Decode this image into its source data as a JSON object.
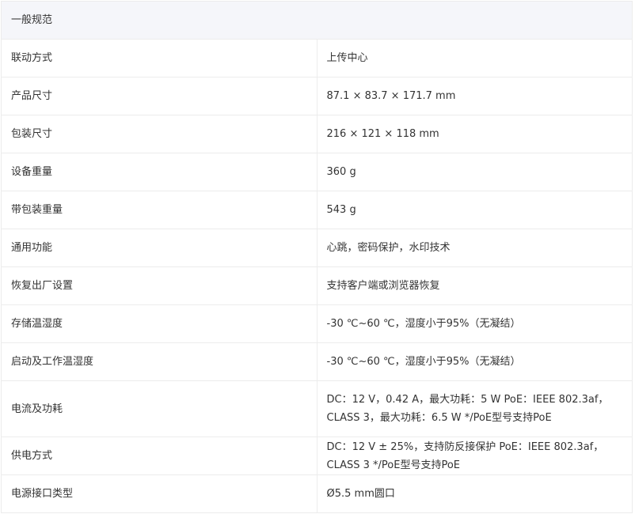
{
  "section_title": "一般规范",
  "rows": [
    {
      "label": "联动方式",
      "value": "上传中心"
    },
    {
      "label": "产品尺寸",
      "value": "87.1 × 83.7 × 171.7 mm"
    },
    {
      "label": "包装尺寸",
      "value": "216 × 121 × 118 mm"
    },
    {
      "label": "设备重量",
      "value": "360 g"
    },
    {
      "label": "带包装重量",
      "value": "543 g"
    },
    {
      "label": "通用功能",
      "value": "心跳，密码保护，水印技术"
    },
    {
      "label": "恢复出厂设置",
      "value": "支持客户端或浏览器恢复"
    },
    {
      "label": "存储温湿度",
      "value": "-30 ℃~60 ℃，湿度小于95%（无凝结）"
    },
    {
      "label": "启动及工作温湿度",
      "value": "-30 ℃~60 ℃，湿度小于95%（无凝结）"
    },
    {
      "label": "电流及功耗",
      "value": "DC：12 V，0.42 A，最大功耗：5 W PoE：IEEE 802.3af，CLASS 3，最大功耗：6.5 W */PoE型号支持PoE"
    },
    {
      "label": "供电方式",
      "value": "DC：12 V ± 25%，支持防反接保护 PoE：IEEE 802.3af，CLASS 3 */PoE型号支持PoE"
    },
    {
      "label": "电源接口类型",
      "value": "Ø5.5 mm圆口"
    }
  ]
}
